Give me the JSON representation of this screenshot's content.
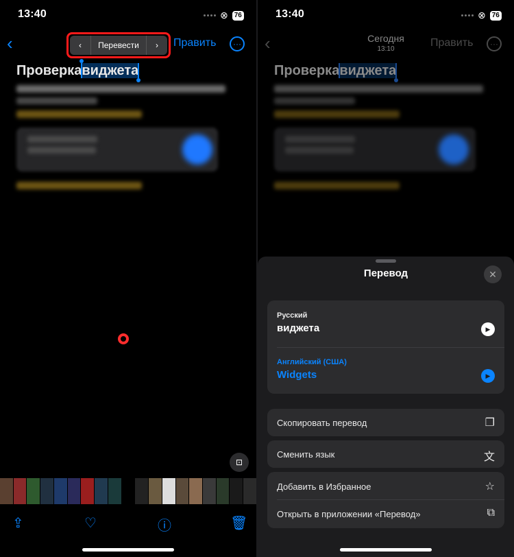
{
  "left": {
    "time": "13:40",
    "battery": "76",
    "nav": {
      "back": "‹",
      "edit": "Править",
      "more": "···"
    },
    "translate_menu": {
      "prev": "‹",
      "label": "Перевести",
      "next": "›"
    },
    "doc": {
      "title_plain": "Проверка",
      "title_selected": "виджета"
    },
    "toolbar": {
      "share": "share-icon",
      "like": "heart-icon",
      "info": "info-icon",
      "delete": "trash-icon"
    }
  },
  "right": {
    "time": "13:40",
    "battery": "76",
    "nav": {
      "back": "‹",
      "date": "Сегодня",
      "time": "13:10",
      "edit": "Править",
      "more": "···"
    },
    "doc": {
      "title_plain": "Проверка",
      "title_selected": "виджета"
    },
    "sheet": {
      "title": "Перевод",
      "close": "✕",
      "source_lang": "Русский",
      "source_text": "виджета",
      "target_lang": "Английский (США)",
      "target_text": "Widgets",
      "actions": [
        {
          "label": "Скопировать перевод",
          "icon": "copy-icon"
        },
        {
          "label": "Сменить язык",
          "icon": "language-icon"
        },
        {
          "label": "Добавить в Избранное",
          "icon": "star-icon"
        },
        {
          "label": "Открыть в приложении «Перевод»",
          "icon": "open-external-icon"
        }
      ]
    },
    "colors": {
      "accent": "#0a84ff",
      "sheet_bg": "#1c1c1e",
      "group_bg": "#2c2c2e"
    }
  }
}
